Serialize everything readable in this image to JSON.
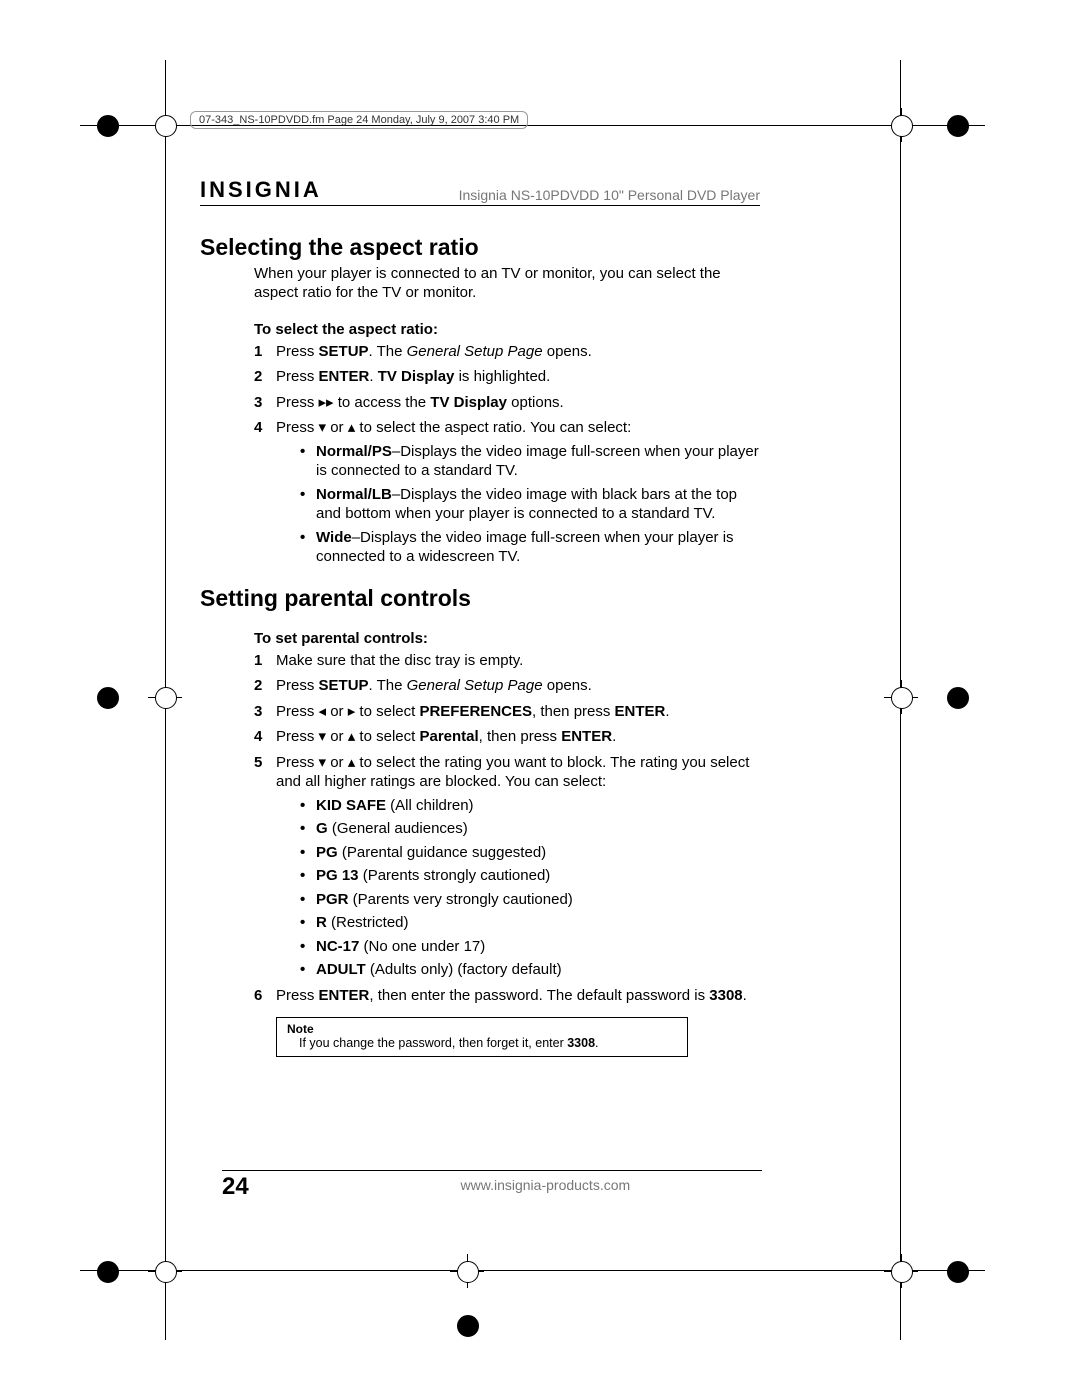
{
  "meta": "07-343_NS-10PDVDD.fm  Page 24  Monday, July 9, 2007  3:40 PM",
  "brand": "INSIGNIA",
  "product": "Insignia NS-10PDVDD 10\" Personal DVD Player",
  "section1": {
    "heading": "Selecting the aspect ratio",
    "intro": "When your player is connected to an TV or monitor, you can select the aspect ratio for the TV or monitor.",
    "subhead": "To select the aspect ratio:",
    "step1_a": "Press ",
    "step1_b": "SETUP",
    "step1_c": ". The ",
    "step1_d": "General Setup Page",
    "step1_e": " opens.",
    "step2_a": "Press ",
    "step2_b": "ENTER",
    "step2_c": ". ",
    "step2_d": "TV Display",
    "step2_e": " is highlighted.",
    "step3_a": "Press ",
    "step3_sym": "▸▸",
    "step3_b": " to access the ",
    "step3_c": "TV Display",
    "step3_d": " options.",
    "step4_a": "Press ",
    "step4_sym1": "▾",
    "step4_b": " or ",
    "step4_sym2": "▴",
    "step4_c": " to select the aspect ratio. You can select:",
    "opt1_b": "Normal/PS",
    "opt1_t": "–Displays the video image full-screen when your player is connected to a standard TV.",
    "opt2_b": "Normal/LB",
    "opt2_t": "–Displays the video image with black bars at the top and bottom when your player is connected to a standard TV.",
    "opt3_b": "Wide",
    "opt3_t": "–Displays the video image full-screen when your player is connected to a widescreen TV."
  },
  "section2": {
    "heading": "Setting parental controls",
    "subhead": "To set parental controls:",
    "step1": "Make sure that the disc tray is empty.",
    "step2_a": "Press ",
    "step2_b": "SETUP",
    "step2_c": ". The ",
    "step2_d": "General Setup Page",
    "step2_e": " opens.",
    "step3_a": "Press ",
    "step3_sym1": "◂",
    "step3_b": " or ",
    "step3_sym2": "▸",
    "step3_c": " to select ",
    "step3_d": "PREFERENCES",
    "step3_e": ", then press ",
    "step3_f": "ENTER",
    "step3_g": ".",
    "step4_a": "Press ",
    "step4_sym1": "▾",
    "step4_b": " or ",
    "step4_sym2": "▴",
    "step4_c": " to select ",
    "step4_d": "Parental",
    "step4_e": ", then press ",
    "step4_f": "ENTER",
    "step4_g": ".",
    "step5_a": "Press ",
    "step5_sym1": "▾",
    "step5_b": " or ",
    "step5_sym2": "▴",
    "step5_c": " to select the rating you want to block. The rating you select and all higher ratings are blocked. You can select:",
    "r1_b": "KID SAFE",
    "r1_t": " (All children)",
    "r2_b": "G",
    "r2_t": " (General audiences)",
    "r3_b": "PG",
    "r3_t": " (Parental guidance suggested)",
    "r4_b": "PG 13",
    "r4_t": " (Parents strongly cautioned)",
    "r5_b": "PGR",
    "r5_t": " (Parents very strongly cautioned)",
    "r6_b": "R",
    "r6_t": " (Restricted)",
    "r7_b": "NC-17",
    "r7_t": " (No one under 17)",
    "r8_b": "ADULT",
    "r8_t": " (Adults only) (factory default)",
    "step6_a": "Press ",
    "step6_b": "ENTER",
    "step6_c": ", then enter the password. The default password is ",
    "step6_d": "3308",
    "step6_e": "."
  },
  "note": {
    "title": "Note",
    "body_a": "If you change the password, then forget it, enter ",
    "body_b": "3308",
    "body_c": "."
  },
  "footer": {
    "page": "24",
    "url": "www.insignia-products.com"
  }
}
